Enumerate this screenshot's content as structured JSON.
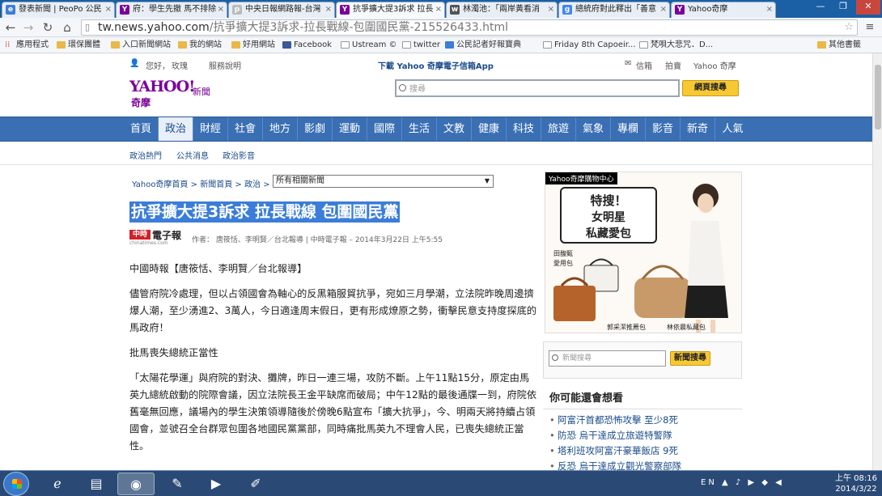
{
  "browser": {
    "tabs": [
      {
        "label": "發表新聞 | PeoPo 公民",
        "icon": "e"
      },
      {
        "label": "府：學生先撤 馬不排除",
        "icon": "Y"
      },
      {
        "label": "中央日報網路報-台灣",
        "icon": "p"
      },
      {
        "label": "抗爭擴大提3訴求 拉長",
        "icon": "Y"
      },
      {
        "label": "林濁池：「兩岸黃看消",
        "icon": "w"
      },
      {
        "label": "總統府對此釋出「善意",
        "icon": "g"
      },
      {
        "label": "Yahoo奇摩",
        "icon": "Y"
      }
    ],
    "url_host": "tw.news.yahoo.com",
    "url_path": "/抗爭擴大提3訴求-拉長戰線-包圍國民黨-215526433.html",
    "bookmarks": [
      "應用程式",
      "環保團體",
      "入口新聞網站",
      "我的網站",
      "好用網站",
      "Facebook",
      "Ustream ©",
      "twitter",
      "公民記者好報寶典",
      "Friday 8th Capoeir...",
      "梵唄大悲咒．D...",
      "其他書籤"
    ]
  },
  "header": {
    "greeting": "您好，",
    "user": "玫瑰",
    "service": "服務說明",
    "promo": "下載 Yahoo 奇摩電子信箱App",
    "mail": "信箱",
    "auction": "拍賣",
    "yahoo_home": "Yahoo 奇摩",
    "logo_main": "YAHOO!",
    "logo_sub": "奇摩",
    "logo_section": "新聞",
    "search_placeholder": "搜尋",
    "search_button": "網頁搜尋"
  },
  "nav": {
    "items": [
      "首頁",
      "政治",
      "財經",
      "社會",
      "地方",
      "影劇",
      "運動",
      "國際",
      "生活",
      "文教",
      "健康",
      "科技",
      "旅遊",
      "氣象",
      "專欄",
      "影音",
      "新奇",
      "人氣"
    ],
    "active": "政治",
    "sub": [
      "政治熱門",
      "公共消息",
      "政治影音"
    ]
  },
  "breadcrumb": {
    "home": "Yahoo奇摩首頁",
    "news": "新聞首頁",
    "section": "政治",
    "related_select": "所有相關新聞",
    "sep": ">"
  },
  "article": {
    "title": "抗爭擴大提3訴求 拉長戰線 包圍國民黨",
    "source_logo": "中時",
    "source_logo_text": "電子報",
    "source_url": "chinatimes.com",
    "byline": "作者： 唐筱恬、李明賢／台北報導 | 中時電子報 – 2014年3月22日 上午5:55",
    "paragraphs": [
      "中國時報【唐筱恬、李明賢／台北報導】",
      "儘管府院冷處理，但以占領國會為軸心的反黑箱服貿抗爭，宛如三月學潮，立法院昨晚周邊擠爆人潮，至少湧進2、3萬人，今日適逢周末假日，更有形成燎原之勢，衝擊民意支持度探底的馬政府！",
      "批馬喪失總統正當性",
      "「太陽花學運」與府院的對決、攤牌，昨日一連三場，攻防不斷。上午11點15分，原定由馬英九總統啟動的院際會議，因立法院長王金平缺席而破局；中午12點的最後通牒一到，府院依舊毫無回應，議場內的學生決策領導隨後於傍晚6點宣布「擴大抗爭」，今、明兩天將持續占領國會，並號召全台群眾包圍各地國民黨黨部，同時痛批馬英九不理會人民，已喪失總統正當性。"
    ]
  },
  "sidebar": {
    "ad_tag": "Yahoo奇摩購物中心",
    "ad_line1": "特搜！",
    "ad_line2": "女明星",
    "ad_line3": "私藏愛包",
    "ad_label1": "田馥甄",
    "ad_label2": "愛用包",
    "ad_label3": "郭采潔推薦包",
    "ad_label4": "林依晨私藏包",
    "news_search_placeholder": "新聞搜尋",
    "news_search_button": "新聞搜尋",
    "related_title": "你可能還會想看",
    "related": [
      "阿富汗首都恐怖攻擊 至少8死",
      "防恐 烏干達成立旅遊特警隊",
      "塔利班攻阿富汗豪華飯店 9死",
      "反恐 烏干達成立觀光警察部隊"
    ]
  },
  "taskbar": {
    "time": "上午 08:16",
    "date": "2014/3/22",
    "tray": "EN ▲ ♪ ▶ ◆ ◀"
  }
}
